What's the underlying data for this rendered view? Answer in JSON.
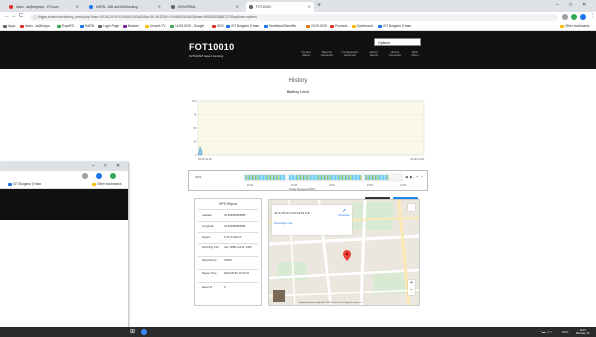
{
  "browser": {
    "tabs": [
      {
        "title": "Inbox - ta@fotgroup - FO.com",
        "color": "#d93025"
      },
      {
        "title": "HARN - 606 and 608 tracking",
        "color": "#1a73e8"
      },
      {
        "title": "UNIVERSAL",
        "color": "#5f6368"
      },
      {
        "title": "FOT10010",
        "color": "#5f6368",
        "active": true
      }
    ],
    "new_tab": "+",
    "window_controls": [
      "–",
      "□",
      "✕"
    ],
    "nav": {
      "back": "←",
      "forward": "→",
      "reload": "C",
      "home": "⌂"
    },
    "url": "fotgps.eu/service/history_result.php?from=30.08.2019+13%3A02%3A00&to=30.08.2019+14%3A00%3A00&imei=861693038567279&options=options",
    "bookmarks": [
      {
        "label": "Apps",
        "color": "#5f6368"
      },
      {
        "label": "Inbox - ta@fotgro",
        "color": "#d93025"
      },
      {
        "label": "ExpoRS",
        "color": "#34a853"
      },
      {
        "label": "HARN",
        "color": "#1a73e8"
      },
      {
        "label": "Login Page",
        "color": "#5f6368"
      },
      {
        "label": "Brainee",
        "color": "#7b1fa2"
      },
      {
        "label": "Uniweb TV",
        "color": "#fbbc04"
      },
      {
        "label": "14.05.2019 - Google",
        "color": "#34a853"
      },
      {
        "label": "HDX",
        "color": "#d93025"
      },
      {
        "label": "GIT Bulgaria | Нова",
        "color": "#1a73e8"
      },
      {
        "label": "Heathland Benefits",
        "color": "#1a73e8"
      },
      {
        "label": "20.09.2019",
        "color": "#e8710a"
      },
      {
        "label": "Products",
        "color": "#d93025"
      },
      {
        "label": "Dashboard",
        "color": "#fbbc04"
      },
      {
        "label": "GIT Bulgaria | Нова",
        "color": "#1a73e8"
      },
      {
        "label": "Other bookmarks",
        "color": "#fbbc04"
      }
    ]
  },
  "header": {
    "brand": "FOT10010",
    "subtitle": "GPS/GSM based tracking",
    "options_select": "Options",
    "nav": [
      {
        "l1": "Current",
        "l2": "Status"
      },
      {
        "l1": "Reports",
        "l2": "Generator"
      },
      {
        "l1": "Configuration",
        "l2": "Generator"
      },
      {
        "l1": "History",
        "l2": "Report"
      },
      {
        "l1": "History",
        "l2": "Generator"
      },
      {
        "l1": "Main",
        "l2": "Menu"
      }
    ]
  },
  "page": {
    "title": "History",
    "chart_title": "Battery Level"
  },
  "chart_data": {
    "type": "area",
    "title": "Battery Level",
    "y_ticks": [
      "100",
      "75",
      "50",
      "25",
      "0"
    ],
    "ylim": [
      0,
      110
    ],
    "x_ticks": [
      "30.08 13:02",
      "30.08 14:00"
    ],
    "series": [
      {
        "values": [
          0,
          17,
          13,
          9
        ]
      }
    ],
    "grid": true
  },
  "timeline": {
    "label": "GPS",
    "ticks": [
      "13:32",
      "13:43",
      "13:51",
      "13:54",
      "14:00"
    ],
    "date_label": "Friday 30 August 2019",
    "controls": [
      "◀",
      "▶",
      "+",
      "−"
    ]
  },
  "buttons": {
    "dark": "Edit",
    "blue": "Save"
  },
  "gps_report": {
    "title": "GPS Report",
    "rows": [
      {
        "label": "Latitude",
        "value": "42.696066666656"
      },
      {
        "label": "Longitude",
        "value": "23.324988666666"
      },
      {
        "label": "Speed",
        "value": "0.79 (0.5)km/h"
      },
      {
        "label": "Servicing Cell",
        "value": "Lac: 0089 Cell Id: 4366"
      },
      {
        "label": "Reported by",
        "value": "GPRS"
      },
      {
        "label": "Report Time",
        "value": "2019-08-30 13:32:16"
      },
      {
        "label": "Event Id",
        "value": "0"
      }
    ]
  },
  "map": {
    "coords": "42°41'45.6\"N 23°19'29.9\"E",
    "directions": "Directions",
    "view_bigger": "View larger map",
    "terms": "Keyboard shortcuts  Map data ©2019  Terms of Use  Report a map error",
    "zoom_in": "+",
    "zoom_out": "−",
    "pin_color": "#ea4335"
  },
  "taskbar": {
    "start": "⊞",
    "apps": [
      {
        "color": "#4285f4"
      },
      {
        "color": "#ea4335"
      }
    ],
    "tray": "ENG",
    "time": "14:15",
    "date": "Monday, 30"
  }
}
